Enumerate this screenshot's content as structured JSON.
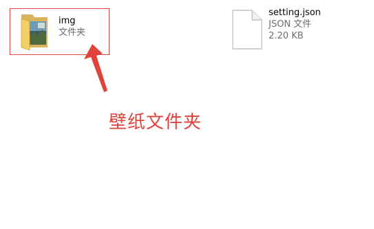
{
  "files": [
    {
      "name": "img",
      "type": "文件夹",
      "icon": "folder-icon"
    },
    {
      "name": "setting.json",
      "type": "JSON 文件",
      "size": "2.20 KB",
      "icon": "json-file-icon"
    }
  ],
  "annotation": {
    "label": "壁纸文件夹",
    "color": "#e0433c"
  }
}
